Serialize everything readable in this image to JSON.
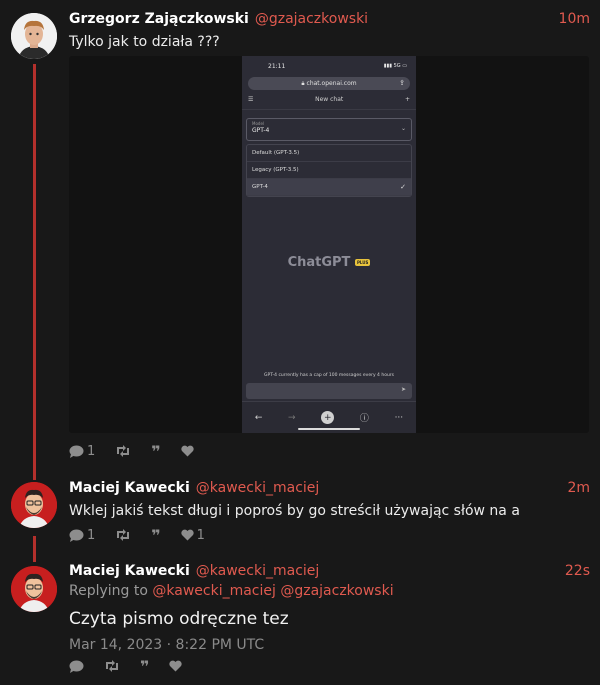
{
  "post1": {
    "author": "Grzegorz Zajączkowski",
    "handle": "@gzajaczkowski",
    "time": "10m",
    "text": "Tylko jak to działa ???",
    "replies": "1",
    "likes": ""
  },
  "phone": {
    "clock": "21:11",
    "signal": "5G",
    "url": "chat.openai.com",
    "nav_title": "New chat",
    "select_label": "Model",
    "select_value": "GPT-4",
    "options": [
      "Default (GPT-3.5)",
      "Legacy (GPT-3.5)",
      "GPT-4"
    ],
    "brand": "ChatGPT",
    "badge": "PLUS",
    "cap_text": "GPT-4 currently has a cap of 100 messages every 4 hours"
  },
  "post2": {
    "author": "Maciej Kawecki",
    "handle": "@kawecki_maciej",
    "time": "2m",
    "text": "Wklej jakiś tekst długi i poproś by go streścił używając słów na a",
    "replies": "1",
    "likes": "1"
  },
  "post3": {
    "author": "Maciej Kawecki",
    "handle": "@kawecki_maciej",
    "time": "22s",
    "replying_prefix": "Replying to",
    "replying_to": "@kawecki_maciej @gzajaczkowski",
    "text": "Czyta pismo odręczne tez",
    "date": "Mar 14, 2023 · 8:22 PM UTC"
  },
  "colors": {
    "accent": "#e05a4f",
    "thread": "#b3302c",
    "background": "#181818"
  }
}
